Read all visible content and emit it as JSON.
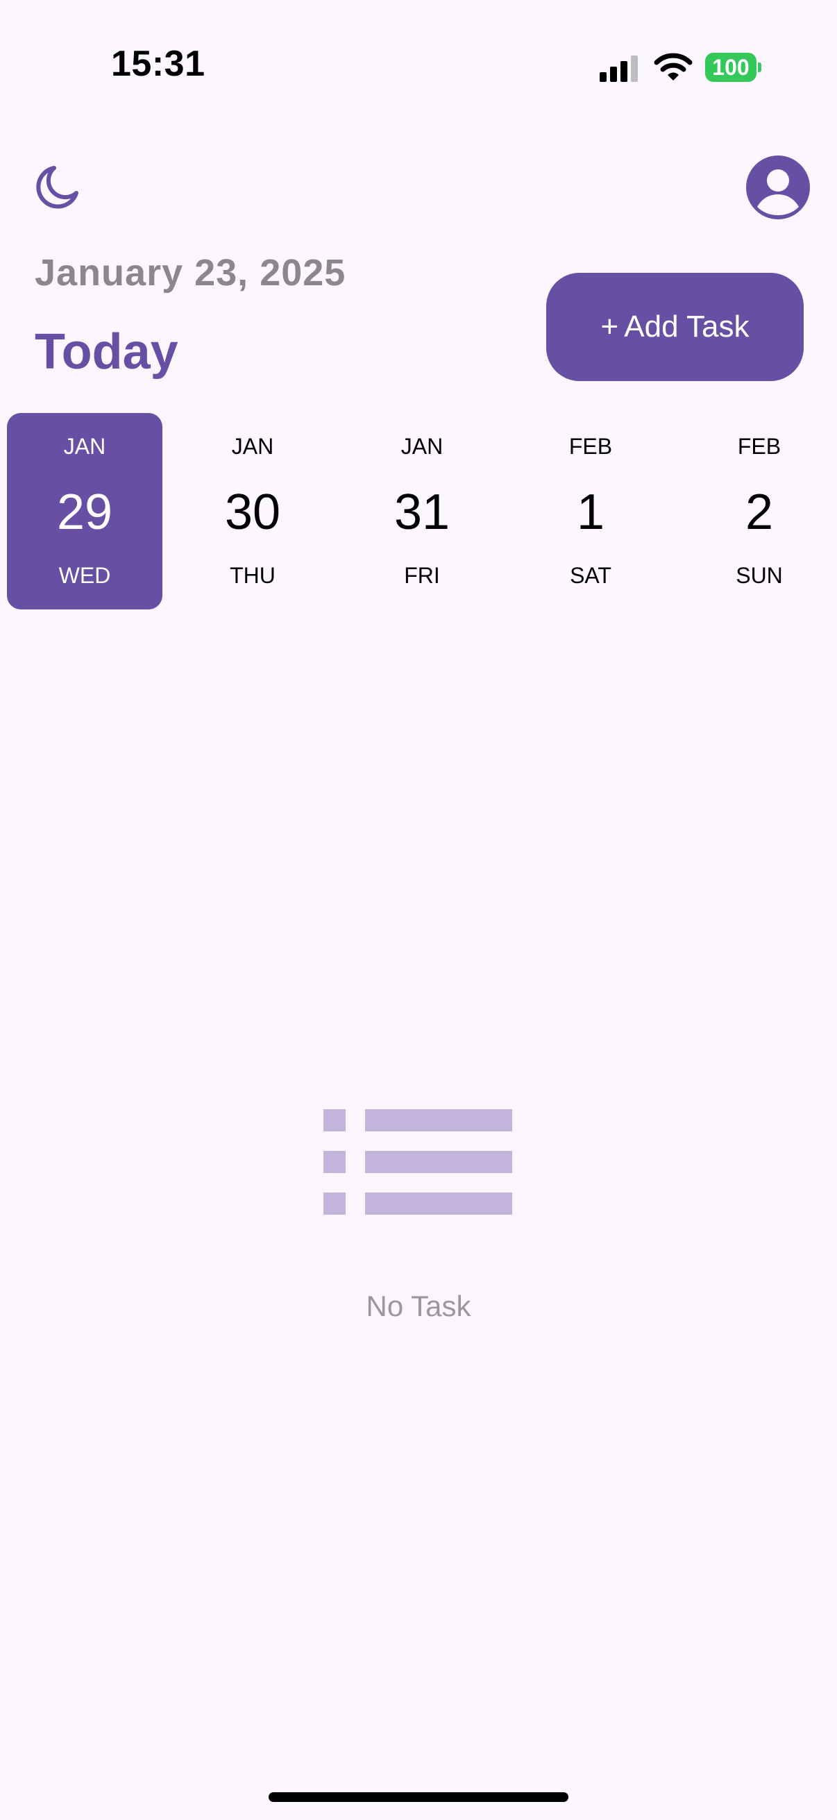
{
  "status_bar": {
    "time": "15:31",
    "battery": "100",
    "icons": [
      "signal-icon",
      "wifi-icon",
      "battery-icon"
    ]
  },
  "header": {
    "theme_icon": "moon-icon",
    "profile_icon": "user-avatar-icon",
    "date_label": "January 23, 2025",
    "title": "Today",
    "add_task_label": "Add Task",
    "add_task_icon": "+"
  },
  "date_strip": {
    "days": [
      {
        "month": "JAN",
        "day": "29",
        "weekday": "WED",
        "selected": true
      },
      {
        "month": "JAN",
        "day": "30",
        "weekday": "THU",
        "selected": false
      },
      {
        "month": "JAN",
        "day": "31",
        "weekday": "FRI",
        "selected": false
      },
      {
        "month": "FEB",
        "day": "1",
        "weekday": "SAT",
        "selected": false
      },
      {
        "month": "FEB",
        "day": "2",
        "weekday": "SUN",
        "selected": false
      }
    ]
  },
  "empty_state": {
    "icon": "list-icon",
    "message": "No Task"
  },
  "colors": {
    "accent": "#6750A4",
    "background": "#FCF6FE",
    "muted_text": "#8A878E",
    "empty_icon": "#C2B4DA",
    "battery": "#34C759"
  }
}
